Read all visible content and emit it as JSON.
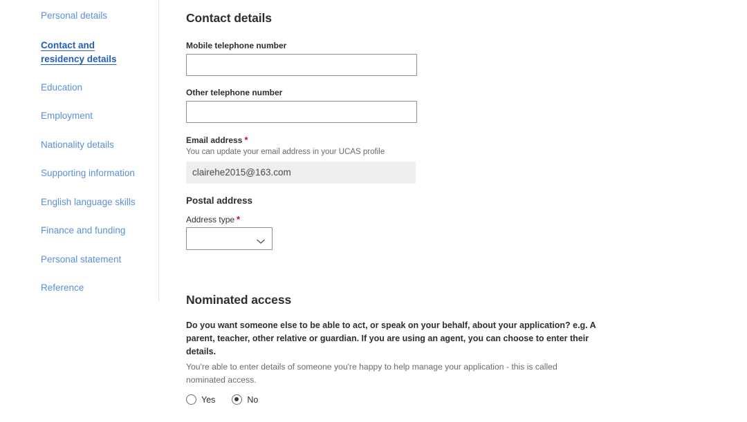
{
  "sidebar": {
    "items": [
      {
        "label": "Personal details",
        "active": false
      },
      {
        "label": "Contact and residency details",
        "active": true
      },
      {
        "label": "Education",
        "active": false
      },
      {
        "label": "Employment",
        "active": false
      },
      {
        "label": "Nationality details",
        "active": false
      },
      {
        "label": "Supporting information",
        "active": false
      },
      {
        "label": "English language skills",
        "active": false
      },
      {
        "label": "Finance and funding",
        "active": false
      },
      {
        "label": "Personal statement",
        "active": false
      },
      {
        "label": "Reference",
        "active": false
      }
    ]
  },
  "contact": {
    "title": "Contact details",
    "mobile": {
      "label": "Mobile telephone number",
      "value": "",
      "placeholder": ""
    },
    "other": {
      "label": "Other telephone number",
      "value": "",
      "placeholder": ""
    },
    "email": {
      "label": "Email address",
      "required_marker": "*",
      "hint": "You can update your email address in your UCAS profile",
      "value": "clairehe2015@163.com"
    },
    "postal": {
      "heading": "Postal address",
      "address_type_label": "Address type",
      "required_marker": "*",
      "address_type_value": "",
      "options": [
        ""
      ]
    }
  },
  "nominated": {
    "title": "Nominated access",
    "question": "Do you want someone else to be able to act, or speak on your behalf, about your application? e.g. A parent, teacher, other relative or guardian. If you are using an agent, you can choose to enter their details.",
    "hint": "You're able to enter details of someone you're happy to help manage your application - this is called nominated access.",
    "options": [
      {
        "label": "Yes",
        "selected": false
      },
      {
        "label": "No",
        "selected": true
      }
    ]
  },
  "colors": {
    "link": "#5b8fd6",
    "link_active": "#1f5fb5",
    "required": "#d4003c",
    "text": "#2e2e2e",
    "hint": "#6a6a6a",
    "input_border": "#8e8e8e",
    "readonly_bg": "#eeeeee",
    "divider": "#e4e6e8"
  }
}
